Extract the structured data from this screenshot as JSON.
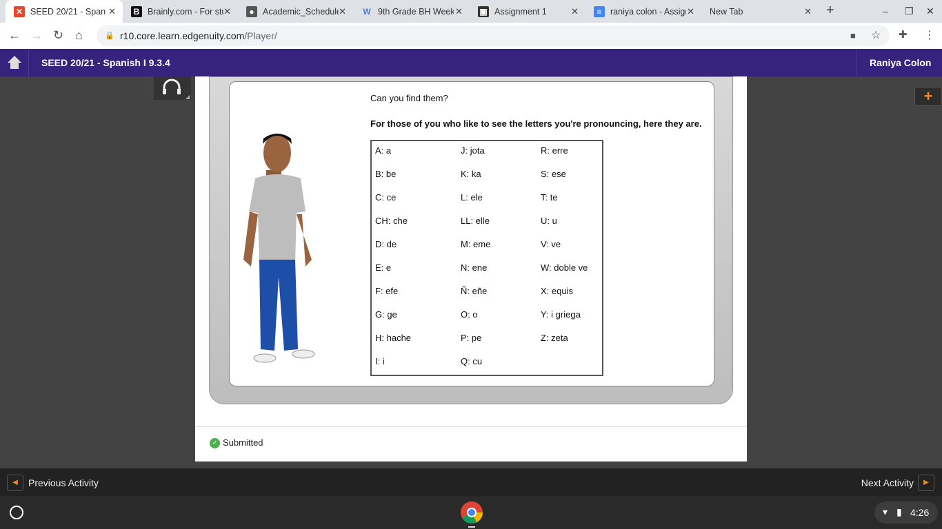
{
  "browser": {
    "tabs": [
      {
        "label": "SEED 20/21 - Spanish I",
        "icon": "edgenuity-x-icon",
        "active": true
      },
      {
        "label": "Brainly.com - For students",
        "icon": "brainly-icon"
      },
      {
        "label": "Academic_Schedule",
        "icon": "globe-icon"
      },
      {
        "label": "9th Grade BH Weekly",
        "icon": "word-icon"
      },
      {
        "label": "Assignment 1",
        "icon": "classroom-icon"
      },
      {
        "label": "raniya colon - Assignment",
        "icon": "docs-icon"
      },
      {
        "label": "New Tab",
        "icon": "none"
      }
    ],
    "url_host": "r10.core.learn.edgenuity.com",
    "url_path": "/Player/"
  },
  "header": {
    "title": "SEED 20/21 - Spanish I 9.3.4",
    "user": "Raniya Colon"
  },
  "lesson": {
    "question": "Can you find them?",
    "lead": "For those of you who like to see the letters you're pronouncing, here they are.",
    "alphabet_columns": [
      [
        "A: a",
        "B: be",
        "C: ce",
        "CH: che",
        "D: de",
        "E: e",
        "F: efe",
        "G: ge",
        "H: hache",
        "I: i"
      ],
      [
        "J: jota",
        "K: ka",
        "L: ele",
        "LL: elle",
        "M: eme",
        "N: ene",
        "Ñ: eñe",
        "O: o",
        "P: pe",
        "Q: cu"
      ],
      [
        "R: erre",
        "S: ese",
        "T: te",
        "U: u",
        "V: ve",
        "W: doble ve",
        "X: equis",
        "Y: i griega",
        "Z: zeta"
      ]
    ]
  },
  "status": {
    "label": "Submitted"
  },
  "footer": {
    "prev": "Previous Activity",
    "next": "Next Activity"
  },
  "shelf": {
    "time": "4:26"
  },
  "colors": {
    "header": "#35237e",
    "accent": "#f08a24",
    "submitted": "#4caf50"
  }
}
